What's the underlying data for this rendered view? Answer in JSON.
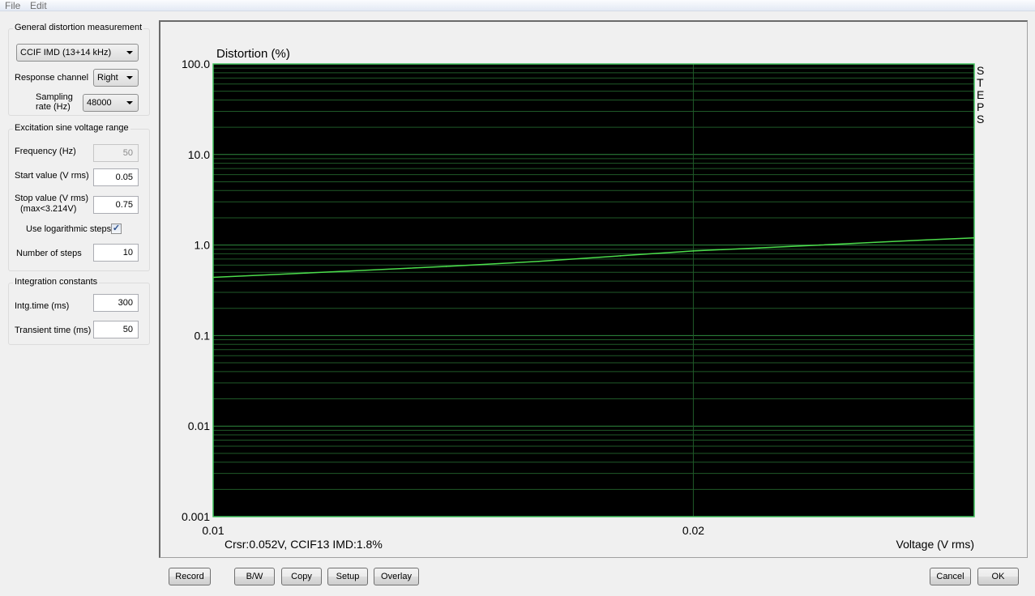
{
  "menu": {
    "items": [
      "File",
      "Edit"
    ]
  },
  "general": {
    "title": "General distortion measurement",
    "measurement_type": "CCIF IMD (13+14 kHz)",
    "response_channel_label": "Response channel",
    "response_channel": "Right",
    "sampling_rate_label_1": "Sampling",
    "sampling_rate_label_2": "rate (Hz)",
    "sampling_rate": "48000"
  },
  "excitation": {
    "title": "Excitation sine voltage range",
    "frequency_label": "Frequency (Hz)",
    "frequency": "50",
    "start_label": "Start value (V rms)",
    "start": "0.05",
    "stop_label_1": "Stop value (V rms)",
    "stop_label_2": "(max<3.214V)",
    "stop": "0.75",
    "log_steps_label": "Use logarithmic steps",
    "log_steps_checked": true,
    "log_steps_mark": "✓",
    "num_steps_label": "Number of steps",
    "num_steps": "10"
  },
  "integration": {
    "title": "Integration constants",
    "intg_label": "Intg.time (ms)",
    "intg": "300",
    "transient_label": "Transient time (ms)",
    "transient": "50"
  },
  "buttons": {
    "record": "Record",
    "bw": "B/W",
    "copy": "Copy",
    "setup": "Setup",
    "overlay": "Overlay",
    "cancel": "Cancel",
    "ok": "OK"
  },
  "colors": {
    "plot_bg": "#000000",
    "grid_major": "#2e8b3e",
    "grid_minor": "#1f5a28",
    "trace": "#4cdc4c",
    "frame": "#3fbf5a"
  },
  "chart_data": {
    "type": "line",
    "title": "",
    "ylabel": "Distortion (%)",
    "xlabel": "Voltage (V rms)",
    "side_label": "STEPS",
    "cursor_readout": "Crsr:0.052V, CCIF13 IMD:1.8%",
    "x_scale": "log",
    "y_scale": "log",
    "xlim": [
      0.01,
      0.03
    ],
    "ylim": [
      0.001,
      100
    ],
    "x_ticks": [
      {
        "value": 0.01,
        "label": "0.01"
      },
      {
        "value": 0.02,
        "label": "0.02"
      }
    ],
    "y_ticks": [
      {
        "value": 100,
        "label": "100.0"
      },
      {
        "value": 10,
        "label": "10.0"
      },
      {
        "value": 1,
        "label": "1.0"
      },
      {
        "value": 0.1,
        "label": "0.1"
      },
      {
        "value": 0.01,
        "label": "0.01"
      },
      {
        "value": 0.001,
        "label": "0.001"
      }
    ],
    "grid": true,
    "series": [
      {
        "name": "CCIF13 IMD",
        "x": [
          0.01,
          0.012,
          0.014,
          0.016,
          0.018,
          0.02,
          0.022,
          0.024,
          0.026,
          0.028,
          0.03
        ],
        "y": [
          0.44,
          0.51,
          0.58,
          0.66,
          0.76,
          0.86,
          0.93,
          1.0,
          1.07,
          1.14,
          1.2
        ]
      }
    ]
  }
}
